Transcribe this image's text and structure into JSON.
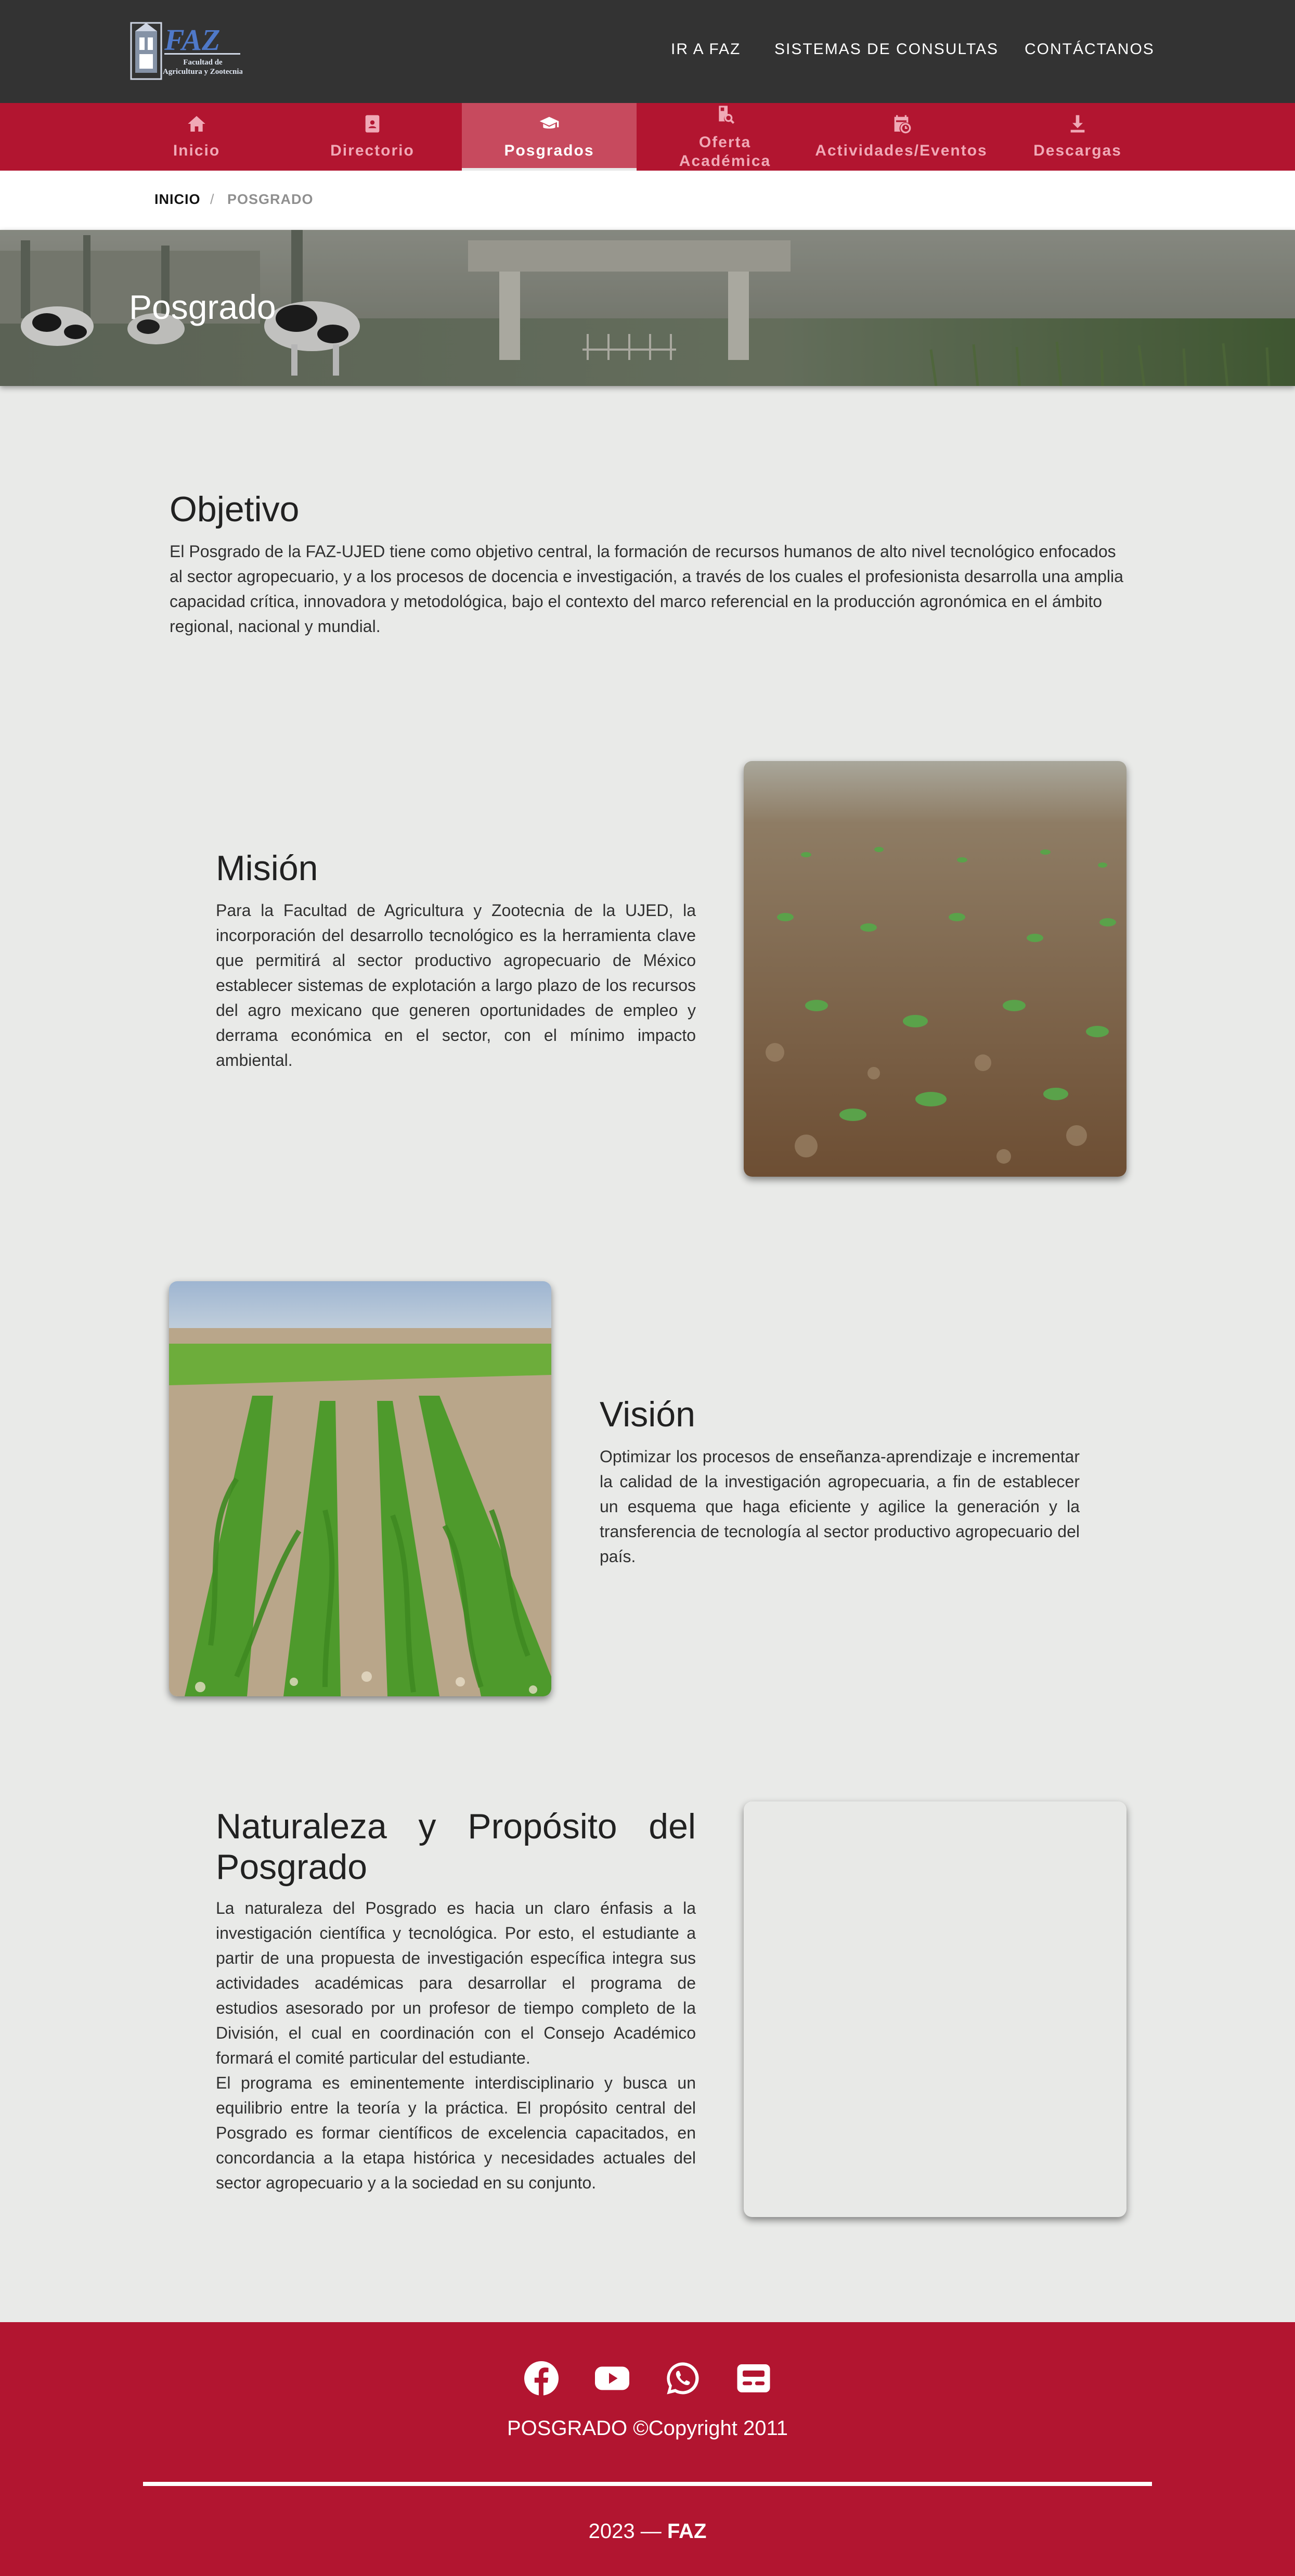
{
  "header": {
    "logo": {
      "letters": "FAZ",
      "subtitle_line1": "Facultad de",
      "subtitle_line2": "Agricultura y Zootecnia"
    },
    "nav": [
      {
        "label": "IR A FAZ"
      },
      {
        "label": "SISTEMAS DE CONSULTAS"
      },
      {
        "label": "CONTÁCTANOS"
      }
    ]
  },
  "subnav": [
    {
      "label": "Inicio",
      "icon": "home-icon",
      "active": false
    },
    {
      "label": "Directorio",
      "icon": "contact-book-icon",
      "active": false
    },
    {
      "label": "Posgrados",
      "icon": "graduation-cap-icon",
      "active": true
    },
    {
      "label_line1": "Oferta",
      "label_line2": "Académica",
      "icon": "document-search-icon",
      "active": false
    },
    {
      "label": "Actividades/Eventos",
      "icon": "calendar-clock-icon",
      "active": false
    },
    {
      "label": "Descargas",
      "icon": "download-icon",
      "active": false
    }
  ],
  "breadcrumb": {
    "home": "INICIO",
    "separator": "/",
    "current": "POSGRADO"
  },
  "hero": {
    "title": "Posgrado"
  },
  "objetivo": {
    "title": "Objetivo",
    "text": "El Posgrado de la FAZ-UJED tiene como objetivo central, la formación de recursos humanos de alto nivel tecnológico enfocados al sector agropecuario, y a los procesos de docencia e investigación, a través de los cuales el profesionista desarrolla una amplia capacidad crítica, innovadora y metodológica, bajo el contexto del marco referencial en la producción agronómica en el ámbito regional, nacional y mundial."
  },
  "mision": {
    "title": "Misión",
    "text": "Para la Facultad de Agricultura y Zootecnia de la UJED, la incorporación del desarrollo tecnológico es la herramienta clave que permitirá al sector productivo agropecuario de México establecer sistemas de explotación a largo plazo de los recursos del agro mexicano que generen oportunidades de empleo y derrama económica en el sector, con el mínimo impacto ambiental."
  },
  "vision": {
    "title": "Visión",
    "text": "Optimizar los procesos de enseñanza-aprendizaje e incrementar la calidad de la investigación agropecuaria, a fin de establecer un esquema que haga eficiente y agilice la generación y la transferencia de tecnología al sector productivo agropecuario del país."
  },
  "naturaleza": {
    "title": "Naturaleza y Propósito del Posgrado",
    "text1": "La naturaleza del Posgrado es hacia un claro énfasis a la investigación científica y tecnológica. Por esto, el estudiante a partir de una propuesta de investigación específica integra sus actividades académicas para desarrollar el programa de estudios asesorado por un profesor de tiempo completo de la División, el cual en coordinación con el Consejo Académico formará el comité particular del estudiante.",
    "text2": "El programa es eminentemente interdisciplinario y busca un equilibrio entre la teoría y la práctica. El propósito central del Posgrado es formar científicos de excelencia capacitados, en concordancia a la etapa histórica y necesidades actuales del sector agropecuario y a la sociedad en su conjunto."
  },
  "footer": {
    "social": [
      {
        "icon": "facebook-icon"
      },
      {
        "icon": "youtube-icon"
      },
      {
        "icon": "whatsapp-icon"
      },
      {
        "icon": "news-icon"
      }
    ],
    "copyright": "POSGRADO ©Copyright 2011",
    "year_prefix": "2023 — ",
    "brand": "FAZ"
  },
  "colors": {
    "topbar": "#333333",
    "accent": "#b21530",
    "active_tab": "#c74a5e",
    "page_bg": "#e9eae8"
  }
}
